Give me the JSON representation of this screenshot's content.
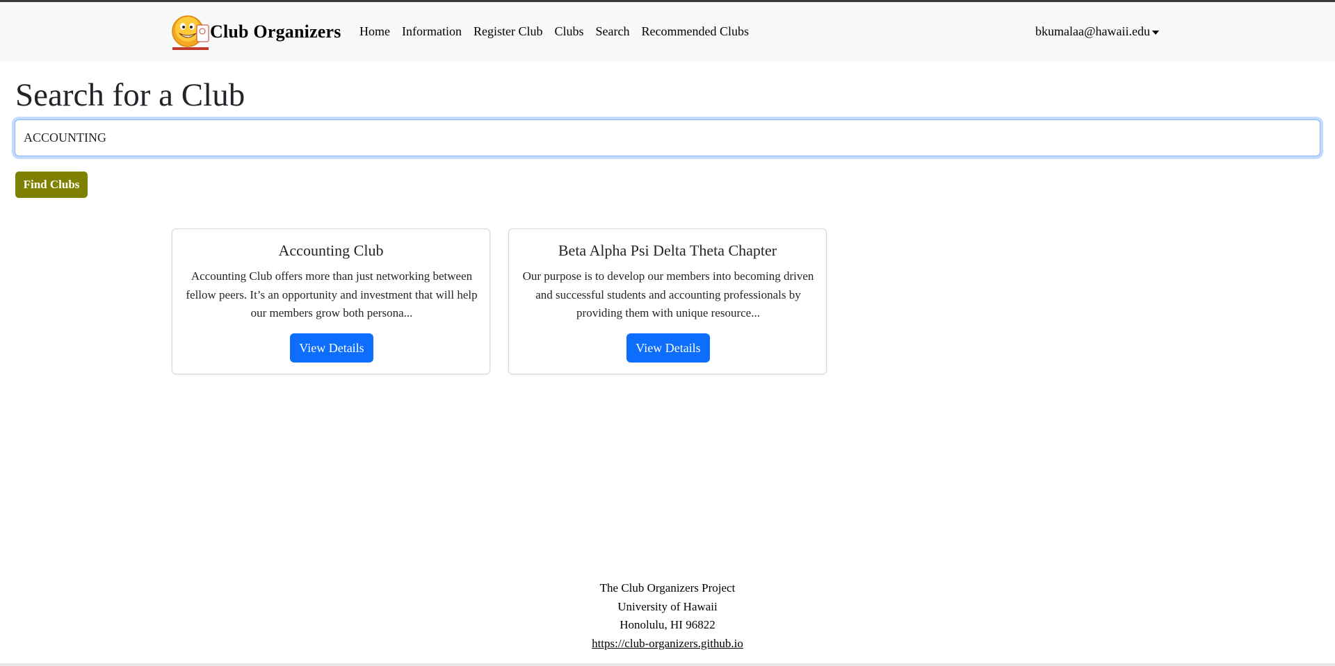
{
  "navbar": {
    "brand": "Club Organizers",
    "links": [
      "Home",
      "Information",
      "Register Club",
      "Clubs",
      "Search",
      "Recommended Clubs"
    ],
    "user": "bkumalaa@hawaii.edu"
  },
  "page": {
    "title": "Search for a Club",
    "search_value": "ACCOUNTING",
    "find_button": "Find Clubs"
  },
  "results": [
    {
      "title": "Accounting Club",
      "description": "Accounting Club offers more than just networking between fellow peers. It’s an opportunity and investment that will help our members grow both persona...",
      "button": "View Details"
    },
    {
      "title": "Beta Alpha Psi Delta Theta Chapter",
      "description": "Our purpose is to develop our members into becoming driven and successful students and accounting professionals by providing them with unique resource...",
      "button": "View Details"
    }
  ],
  "footer": {
    "line1": "The Club Organizers Project",
    "line2": "University of Hawaii",
    "line3": "Honolulu, HI 96822",
    "link": "https://club-organizers.github.io"
  },
  "colors": {
    "find_button": "#808000",
    "primary_button": "#0d6efd",
    "navbar_bg": "#f8f9fa"
  }
}
